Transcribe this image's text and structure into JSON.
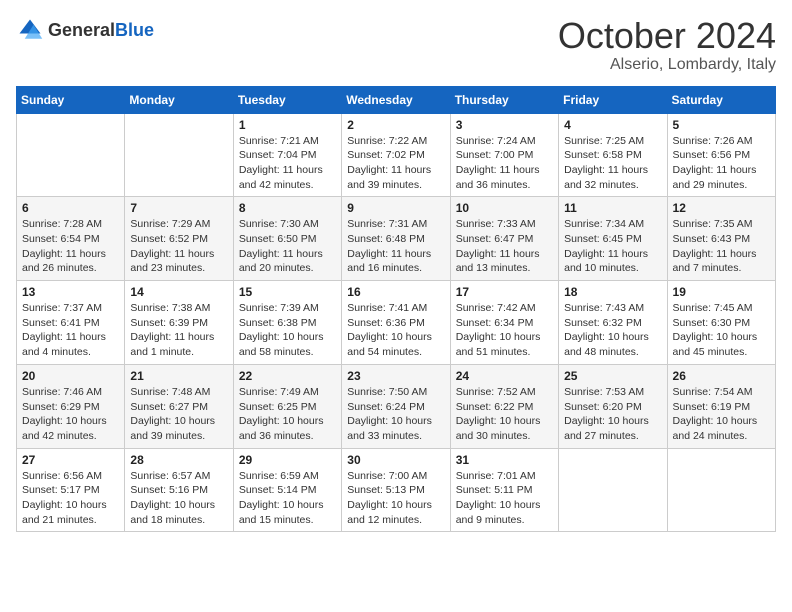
{
  "header": {
    "logo_general": "General",
    "logo_blue": "Blue",
    "month": "October 2024",
    "location": "Alserio, Lombardy, Italy"
  },
  "weekdays": [
    "Sunday",
    "Monday",
    "Tuesday",
    "Wednesday",
    "Thursday",
    "Friday",
    "Saturday"
  ],
  "weeks": [
    [
      {
        "day": "",
        "info": ""
      },
      {
        "day": "",
        "info": ""
      },
      {
        "day": "1",
        "info": "Sunrise: 7:21 AM\nSunset: 7:04 PM\nDaylight: 11 hours and 42 minutes."
      },
      {
        "day": "2",
        "info": "Sunrise: 7:22 AM\nSunset: 7:02 PM\nDaylight: 11 hours and 39 minutes."
      },
      {
        "day": "3",
        "info": "Sunrise: 7:24 AM\nSunset: 7:00 PM\nDaylight: 11 hours and 36 minutes."
      },
      {
        "day": "4",
        "info": "Sunrise: 7:25 AM\nSunset: 6:58 PM\nDaylight: 11 hours and 32 minutes."
      },
      {
        "day": "5",
        "info": "Sunrise: 7:26 AM\nSunset: 6:56 PM\nDaylight: 11 hours and 29 minutes."
      }
    ],
    [
      {
        "day": "6",
        "info": "Sunrise: 7:28 AM\nSunset: 6:54 PM\nDaylight: 11 hours and 26 minutes."
      },
      {
        "day": "7",
        "info": "Sunrise: 7:29 AM\nSunset: 6:52 PM\nDaylight: 11 hours and 23 minutes."
      },
      {
        "day": "8",
        "info": "Sunrise: 7:30 AM\nSunset: 6:50 PM\nDaylight: 11 hours and 20 minutes."
      },
      {
        "day": "9",
        "info": "Sunrise: 7:31 AM\nSunset: 6:48 PM\nDaylight: 11 hours and 16 minutes."
      },
      {
        "day": "10",
        "info": "Sunrise: 7:33 AM\nSunset: 6:47 PM\nDaylight: 11 hours and 13 minutes."
      },
      {
        "day": "11",
        "info": "Sunrise: 7:34 AM\nSunset: 6:45 PM\nDaylight: 11 hours and 10 minutes."
      },
      {
        "day": "12",
        "info": "Sunrise: 7:35 AM\nSunset: 6:43 PM\nDaylight: 11 hours and 7 minutes."
      }
    ],
    [
      {
        "day": "13",
        "info": "Sunrise: 7:37 AM\nSunset: 6:41 PM\nDaylight: 11 hours and 4 minutes."
      },
      {
        "day": "14",
        "info": "Sunrise: 7:38 AM\nSunset: 6:39 PM\nDaylight: 11 hours and 1 minute."
      },
      {
        "day": "15",
        "info": "Sunrise: 7:39 AM\nSunset: 6:38 PM\nDaylight: 10 hours and 58 minutes."
      },
      {
        "day": "16",
        "info": "Sunrise: 7:41 AM\nSunset: 6:36 PM\nDaylight: 10 hours and 54 minutes."
      },
      {
        "day": "17",
        "info": "Sunrise: 7:42 AM\nSunset: 6:34 PM\nDaylight: 10 hours and 51 minutes."
      },
      {
        "day": "18",
        "info": "Sunrise: 7:43 AM\nSunset: 6:32 PM\nDaylight: 10 hours and 48 minutes."
      },
      {
        "day": "19",
        "info": "Sunrise: 7:45 AM\nSunset: 6:30 PM\nDaylight: 10 hours and 45 minutes."
      }
    ],
    [
      {
        "day": "20",
        "info": "Sunrise: 7:46 AM\nSunset: 6:29 PM\nDaylight: 10 hours and 42 minutes."
      },
      {
        "day": "21",
        "info": "Sunrise: 7:48 AM\nSunset: 6:27 PM\nDaylight: 10 hours and 39 minutes."
      },
      {
        "day": "22",
        "info": "Sunrise: 7:49 AM\nSunset: 6:25 PM\nDaylight: 10 hours and 36 minutes."
      },
      {
        "day": "23",
        "info": "Sunrise: 7:50 AM\nSunset: 6:24 PM\nDaylight: 10 hours and 33 minutes."
      },
      {
        "day": "24",
        "info": "Sunrise: 7:52 AM\nSunset: 6:22 PM\nDaylight: 10 hours and 30 minutes."
      },
      {
        "day": "25",
        "info": "Sunrise: 7:53 AM\nSunset: 6:20 PM\nDaylight: 10 hours and 27 minutes."
      },
      {
        "day": "26",
        "info": "Sunrise: 7:54 AM\nSunset: 6:19 PM\nDaylight: 10 hours and 24 minutes."
      }
    ],
    [
      {
        "day": "27",
        "info": "Sunrise: 6:56 AM\nSunset: 5:17 PM\nDaylight: 10 hours and 21 minutes."
      },
      {
        "day": "28",
        "info": "Sunrise: 6:57 AM\nSunset: 5:16 PM\nDaylight: 10 hours and 18 minutes."
      },
      {
        "day": "29",
        "info": "Sunrise: 6:59 AM\nSunset: 5:14 PM\nDaylight: 10 hours and 15 minutes."
      },
      {
        "day": "30",
        "info": "Sunrise: 7:00 AM\nSunset: 5:13 PM\nDaylight: 10 hours and 12 minutes."
      },
      {
        "day": "31",
        "info": "Sunrise: 7:01 AM\nSunset: 5:11 PM\nDaylight: 10 hours and 9 minutes."
      },
      {
        "day": "",
        "info": ""
      },
      {
        "day": "",
        "info": ""
      }
    ]
  ]
}
